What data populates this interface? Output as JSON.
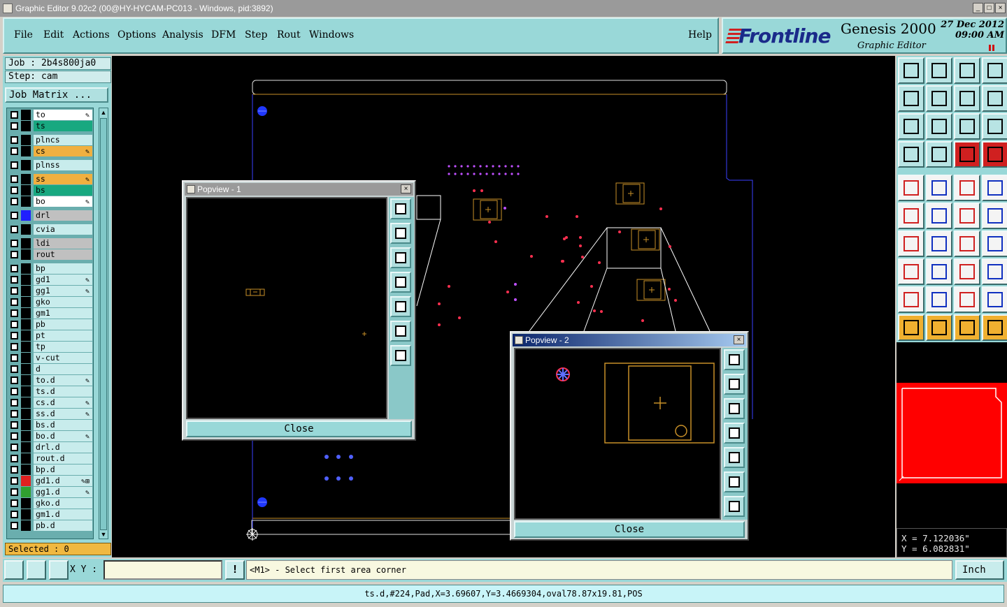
{
  "window": {
    "title": "Graphic Editor 9.02c2 (00@HY-HYCAM-PC013 - Windows, pid:3892)",
    "controls": [
      "_",
      "□",
      "×"
    ]
  },
  "menu": {
    "items": [
      "File",
      "Edit",
      "Actions",
      "Options",
      "Analysis",
      "DFM",
      "Step",
      "Rout",
      "Windows"
    ],
    "help": "Help"
  },
  "brand": {
    "logo": "Frontline",
    "product": "Genesis 2000",
    "subtitle": "Graphic Editor",
    "date_line1": "27 Dec 2012",
    "date_line2": "09:00 AM"
  },
  "job": {
    "job_label": "Job : 2b4s800ja0",
    "step_label": "Step: cam",
    "job_matrix": "Job Matrix ..."
  },
  "layers": [
    {
      "name": "to",
      "style": "white",
      "mark": "✎"
    },
    {
      "name": "ts",
      "style": "teal",
      "mark": ""
    },
    {
      "name": "plncs",
      "style": "",
      "mark": ""
    },
    {
      "name": "cs",
      "style": "orange",
      "mark": "✎"
    },
    {
      "name": "plnss",
      "style": "",
      "mark": ""
    },
    {
      "name": "ss",
      "style": "orange",
      "mark": "✎"
    },
    {
      "name": "bs",
      "style": "teal",
      "mark": ""
    },
    {
      "name": "bo",
      "style": "white",
      "mark": "✎"
    },
    {
      "name": "drl",
      "style": "grey",
      "mark": ""
    },
    {
      "name": "cvia",
      "style": "",
      "mark": ""
    },
    {
      "name": "ldi",
      "style": "grey",
      "mark": ""
    },
    {
      "name": "rout",
      "style": "grey",
      "mark": ""
    },
    {
      "name": "bp",
      "style": "",
      "mark": ""
    },
    {
      "name": "gd1",
      "style": "",
      "mark": "✎"
    },
    {
      "name": "gg1",
      "style": "",
      "mark": "✎"
    },
    {
      "name": "gko",
      "style": "",
      "mark": ""
    },
    {
      "name": "gm1",
      "style": "",
      "mark": ""
    },
    {
      "name": "pb",
      "style": "",
      "mark": ""
    },
    {
      "name": "pt",
      "style": "",
      "mark": ""
    },
    {
      "name": "tp",
      "style": "",
      "mark": ""
    },
    {
      "name": "v-cut",
      "style": "",
      "mark": ""
    },
    {
      "name": "d",
      "style": "",
      "mark": ""
    },
    {
      "name": "to.d",
      "style": "",
      "mark": "✎"
    },
    {
      "name": "ts.d",
      "style": "",
      "mark": ""
    },
    {
      "name": "cs.d",
      "style": "",
      "mark": "✎"
    },
    {
      "name": "ss.d",
      "style": "",
      "mark": "✎"
    },
    {
      "name": "bs.d",
      "style": "",
      "mark": ""
    },
    {
      "name": "bo.d",
      "style": "",
      "mark": "✎"
    },
    {
      "name": "drl.d",
      "style": "",
      "mark": ""
    },
    {
      "name": "rout.d",
      "style": "",
      "mark": ""
    },
    {
      "name": "bp.d",
      "style": "",
      "mark": ""
    },
    {
      "name": "gd1.d",
      "style": "",
      "mark": "✎⊞"
    },
    {
      "name": "gg1.d",
      "style": "",
      "mark": "✎"
    },
    {
      "name": "gko.d",
      "style": "",
      "mark": ""
    },
    {
      "name": "gm1.d",
      "style": "",
      "mark": ""
    },
    {
      "name": "pb.d",
      "style": "",
      "mark": ""
    }
  ],
  "selected": "Selected : 0",
  "popview1": {
    "title": "Popview - 1",
    "close": "Close"
  },
  "popview2": {
    "title": "Popview - 2",
    "close": "Close"
  },
  "coords": {
    "x": "X = 7.122036\"",
    "y": "Y = 6.082831\""
  },
  "bottom": {
    "xy_label": "X Y :",
    "xy_value": "",
    "prompt": "<M1> - Select first area corner",
    "units": "Inch",
    "status": "ts.d,#224,Pad,X=3.69607,Y=3.4669304,oval78.87x19.81,POS"
  },
  "colors": {
    "panel": "#99d8d8",
    "canvas": "#000000",
    "outline_gold": "#c89028",
    "minimap": "#ff0000",
    "pad_red": "#ff3050",
    "pad_blue": "#4040ff"
  }
}
